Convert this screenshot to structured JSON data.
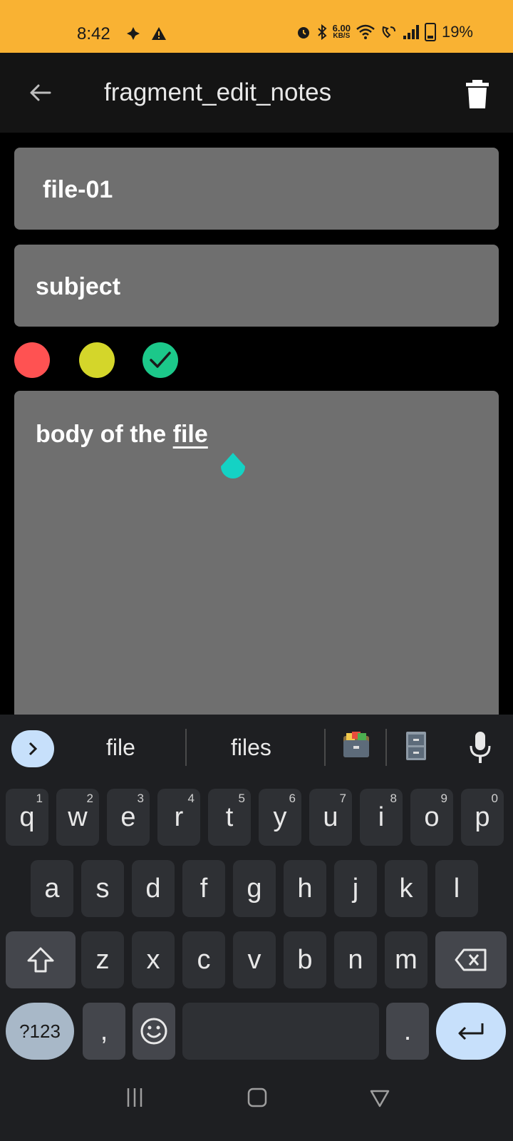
{
  "status_bar": {
    "time": "8:42",
    "net_speed_value": "6.00",
    "net_speed_unit": "KB/S",
    "battery": "19%",
    "icons": [
      "fan-icon",
      "warning-icon",
      "alarm-icon",
      "bluetooth-icon",
      "wifi-icon",
      "wifi-call-icon",
      "signal-icon",
      "battery-icon"
    ]
  },
  "toolbar": {
    "title": "fragment_edit_notes",
    "back_icon": "arrow-back-icon",
    "delete_icon": "trash-icon"
  },
  "note": {
    "title_value": "file-01",
    "subject_value": "subject",
    "body_prefix": "body of the ",
    "body_underlined": "file"
  },
  "colors": {
    "options": [
      {
        "name": "red",
        "hex": "#ff5252"
      },
      {
        "name": "yellow",
        "hex": "#d4d62a"
      },
      {
        "name": "green",
        "hex": "#1cc88a",
        "selected": true
      }
    ],
    "field_bg": "#6f6f6f",
    "status_bar_bg": "#f9b233",
    "handle_color": "#14d2c4"
  },
  "keyboard": {
    "suggestions": [
      "file",
      "files"
    ],
    "emoji_suggestions": [
      "card-file-box-emoji",
      "file-cabinet-emoji"
    ],
    "row1": [
      {
        "key": "q",
        "hint": "1"
      },
      {
        "key": "w",
        "hint": "2"
      },
      {
        "key": "e",
        "hint": "3"
      },
      {
        "key": "r",
        "hint": "4"
      },
      {
        "key": "t",
        "hint": "5"
      },
      {
        "key": "y",
        "hint": "6"
      },
      {
        "key": "u",
        "hint": "7"
      },
      {
        "key": "i",
        "hint": "8"
      },
      {
        "key": "o",
        "hint": "9"
      },
      {
        "key": "p",
        "hint": "0"
      }
    ],
    "row2": [
      "a",
      "s",
      "d",
      "f",
      "g",
      "h",
      "j",
      "k",
      "l"
    ],
    "row3": [
      "z",
      "x",
      "c",
      "v",
      "b",
      "n",
      "m"
    ],
    "mode_key": "?123",
    "comma_key": ",",
    "period_key": "."
  }
}
